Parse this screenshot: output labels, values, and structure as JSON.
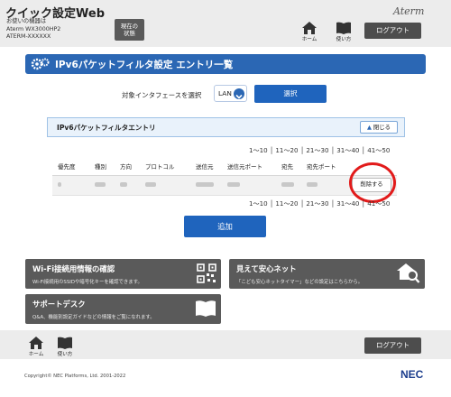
{
  "header": {
    "app_title": "クイック設定Web",
    "device_caption": "お使いの機器は",
    "device_model": "Aterm WX3000HP2",
    "device_id": "ATERM-XXXXXX",
    "status_button_line1": "現在の",
    "status_button_line2": "状態",
    "brand": "Aterm",
    "home_label": "ホーム",
    "help_label": "使い方",
    "logout_label": "ログアウト"
  },
  "page": {
    "title": "IPv6パケットフィルタ設定 エントリ一覧",
    "interface_label": "対象インタフェースを選択",
    "interface_value": "LAN",
    "select_button": "選択"
  },
  "entry_panel": {
    "title": "IPv6パケットフィルタエントリ",
    "close_label": "閉じる"
  },
  "pager": {
    "top": "1～10 │ 11～20 │ 21～30 │ 31～40 │ 41～50",
    "bottom": "1～10 │ 11～20 │ 21～30 │ 31～40 │ 41～50"
  },
  "table": {
    "headers": [
      "優先度",
      "種別",
      "方向",
      "プロトコル",
      "送信元",
      "送信元ポート",
      "宛先",
      "宛先ポート",
      ""
    ],
    "delete_label": "削除する"
  },
  "add_button": "追加",
  "tiles": {
    "wifi": {
      "title": "Wi-Fi接続用情報の確認",
      "desc": "Wi-Fi接続用のSSIDや暗号化キーを確認できます。"
    },
    "mimamori": {
      "title": "見えて安心ネット",
      "desc": "「こども安心ネットタイマー」などの設定はこちらから。"
    },
    "support": {
      "title": "サポートデスク",
      "desc": "Q&A、機能別設定ガイドなどの情報をご覧になれます。"
    }
  },
  "footer": {
    "home_label": "ホーム",
    "help_label": "使い方",
    "logout_label": "ログアウト",
    "copyright": "Copyright© NEC Platforms, Ltd. 2001-2022",
    "nec_logo": "NEC"
  },
  "colors": {
    "primary_blue": "#1f64bd",
    "header_gray": "#ececec",
    "dark_button": "#4d4d4d",
    "highlight_red": "#e21b1b"
  }
}
